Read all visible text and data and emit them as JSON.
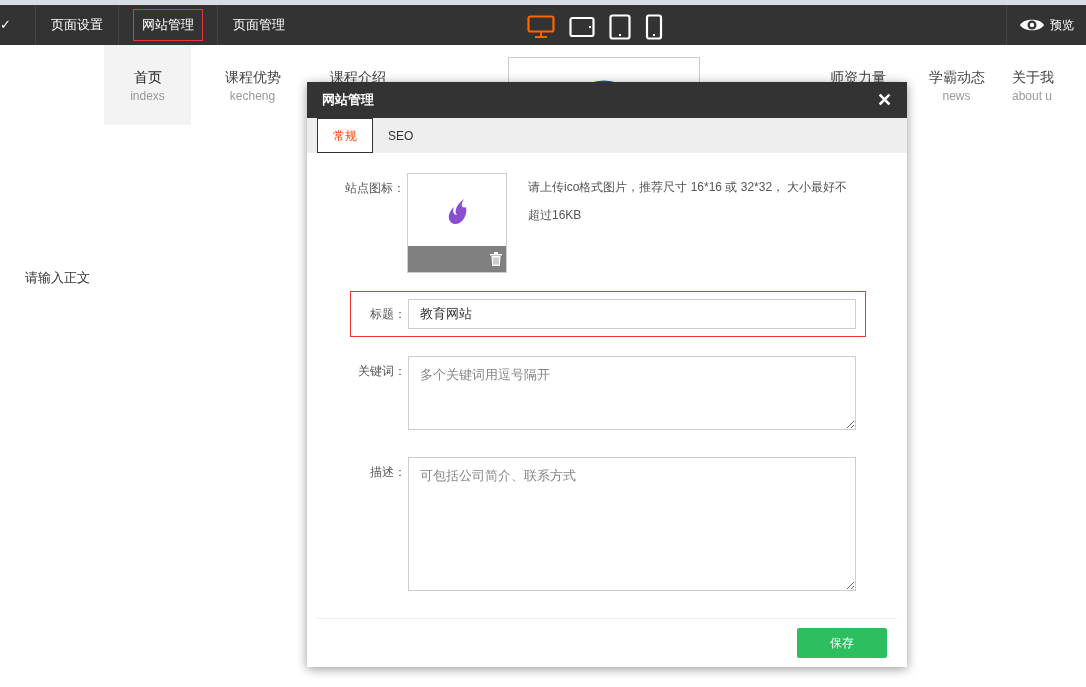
{
  "toolbar": {
    "check": "✓",
    "menu": [
      {
        "label": "页面设置",
        "selected": false
      },
      {
        "label": "网站管理",
        "selected": true
      },
      {
        "label": "页面管理",
        "selected": false
      }
    ],
    "devices": [
      {
        "kind": "desktop",
        "selected": true
      },
      {
        "kind": "tablet-landscape",
        "selected": false
      },
      {
        "kind": "tablet",
        "selected": false
      },
      {
        "kind": "phone",
        "selected": false
      }
    ],
    "preview": "预览"
  },
  "site_nav": {
    "items": [
      {
        "title": "首页",
        "subtitle": "indexs",
        "selected": true
      },
      {
        "title": "课程优势",
        "subtitle": "kecheng",
        "selected": false
      },
      {
        "title": "课程介绍",
        "selected": false
      }
    ],
    "right_items": [
      {
        "title": "师资力量",
        "selected": false
      },
      {
        "title": "学霸动态",
        "subtitle": "news",
        "selected": false
      },
      {
        "title": "关于我",
        "subtitle": "about u",
        "selected": false
      }
    ]
  },
  "body_text": "请输入正文",
  "dialog": {
    "title": "网站管理",
    "close": "✕",
    "tabs": [
      {
        "label": "常规",
        "selected": true
      },
      {
        "label": "SEO",
        "selected": false
      }
    ],
    "favicon": {
      "label": "站点图标：",
      "hint": "请上传ico格式图片，推荐尺寸 16*16 或 32*32， 大小最好不超过16KB"
    },
    "fields": [
      {
        "kind": "input",
        "label": "标题：",
        "value": "教育网站",
        "focused": true
      },
      {
        "kind": "textarea",
        "label": "关键词：",
        "placeholder": "多个关键词用逗号隔开",
        "focused": false
      },
      {
        "kind": "textarea",
        "label": "描述：",
        "placeholder": "可包括公司简介、联系方式",
        "focused": false
      }
    ],
    "save": "保存"
  }
}
